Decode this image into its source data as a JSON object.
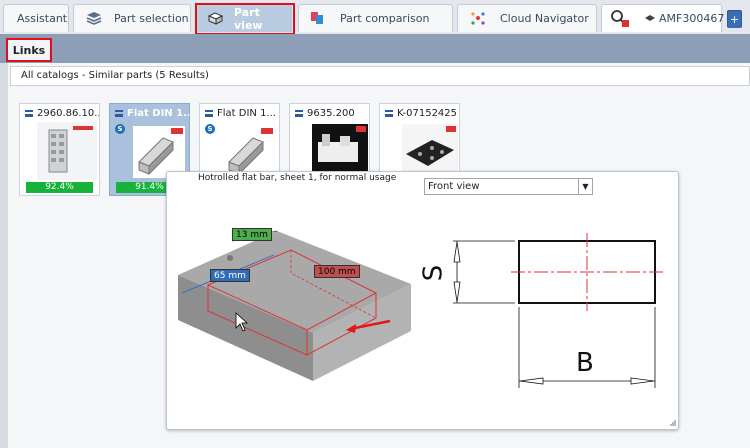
{
  "tabs": [
    {
      "label": "Assistant",
      "icon": "none"
    },
    {
      "label": "Part selection",
      "icon": "layers-icon"
    },
    {
      "label": "Part view",
      "icon": "part-view-icon",
      "active": true
    },
    {
      "label": "Part comparison",
      "icon": "compare-icon"
    },
    {
      "label": "Cloud Navigator",
      "icon": "cloud-navigator-icon"
    },
    {
      "label": "AMF300467",
      "icon": "search-part-icon"
    }
  ],
  "add_tab_label": "+",
  "links_tab": "Links",
  "results_header": "All catalogs - Similar parts (5 Results)",
  "cards": [
    {
      "title": "2960.86.10...",
      "match": "92.4%",
      "selected": false,
      "badge": ""
    },
    {
      "title": "Flat DIN 1...",
      "match": "91.4%",
      "selected": true,
      "badge": "S"
    },
    {
      "title": "Flat DIN 1...",
      "match": "",
      "selected": false,
      "badge": "S"
    },
    {
      "title": "9635.200",
      "match": "",
      "selected": false,
      "badge": ""
    },
    {
      "title": "K-07152425",
      "match": "",
      "selected": false,
      "badge": ""
    }
  ],
  "popup": {
    "title": "Hotrolled flat bar, sheet 1, for normal usage",
    "view_select": "Front view",
    "dims": {
      "a": "13 mm",
      "b": "65 mm",
      "c": "100 mm"
    },
    "drawing_labels": {
      "side": "S",
      "bottom": "B"
    }
  },
  "colors": {
    "highlight": "#e0101a",
    "match_bar": "#17b23b",
    "dim_green": "#4cae4c",
    "dim_blue": "#2f6eb5",
    "dim_red": "#c0504d"
  }
}
